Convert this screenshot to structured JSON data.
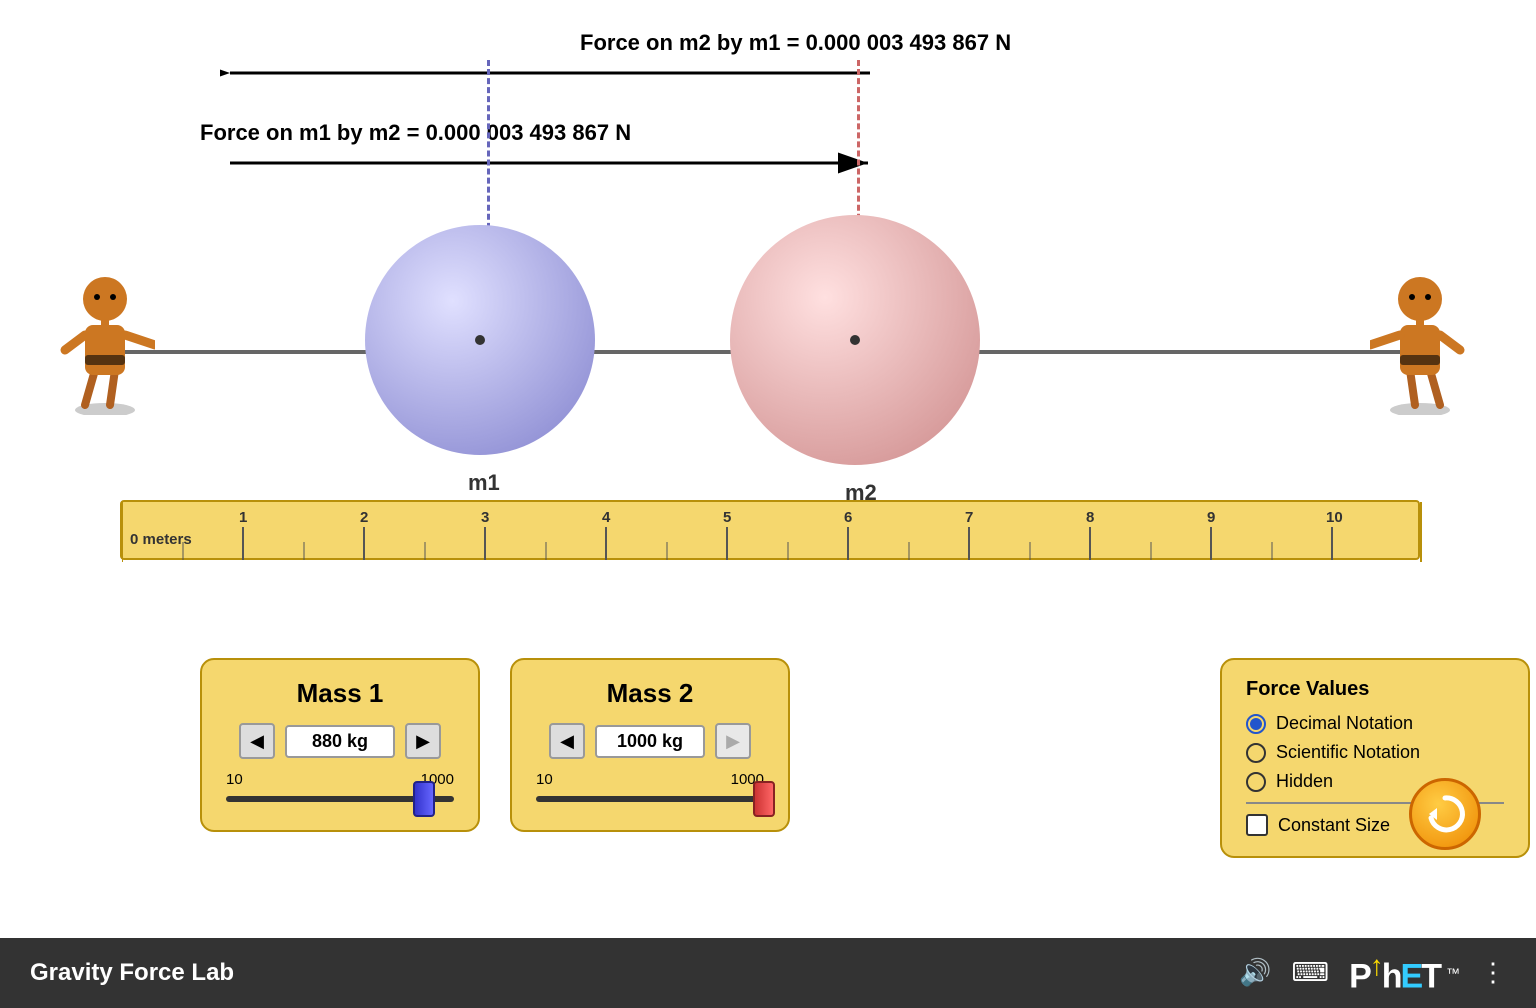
{
  "app": {
    "title": "Gravity Force Lab"
  },
  "forces": {
    "force_on_m2": "Force on m2 by m1 = 0.000 003 493 867 N",
    "force_on_m1": "Force on m1 by m2 = 0.000 003 493 867 N"
  },
  "masses": {
    "m1": {
      "label": "Mass 1",
      "value": "880 kg",
      "min": "10",
      "max": "1000",
      "sphere_label": "m1"
    },
    "m2": {
      "label": "Mass 2",
      "value": "1000 kg",
      "min": "10",
      "max": "1000",
      "sphere_label": "m2"
    }
  },
  "force_values_panel": {
    "title": "Force Values",
    "options": [
      {
        "id": "decimal",
        "label": "Decimal Notation",
        "selected": true
      },
      {
        "id": "scientific",
        "label": "Scientific Notation",
        "selected": false
      },
      {
        "id": "hidden",
        "label": "Hidden",
        "selected": false
      }
    ],
    "constant_size_label": "Constant Size",
    "constant_size_checked": false
  },
  "ruler": {
    "labels": [
      "0 meters",
      "1",
      "2",
      "3",
      "4",
      "5",
      "6",
      "7",
      "8",
      "9",
      "10"
    ]
  },
  "controls": {
    "left_arrow": "◀",
    "right_arrow": "▶",
    "reset_icon": "↺"
  }
}
